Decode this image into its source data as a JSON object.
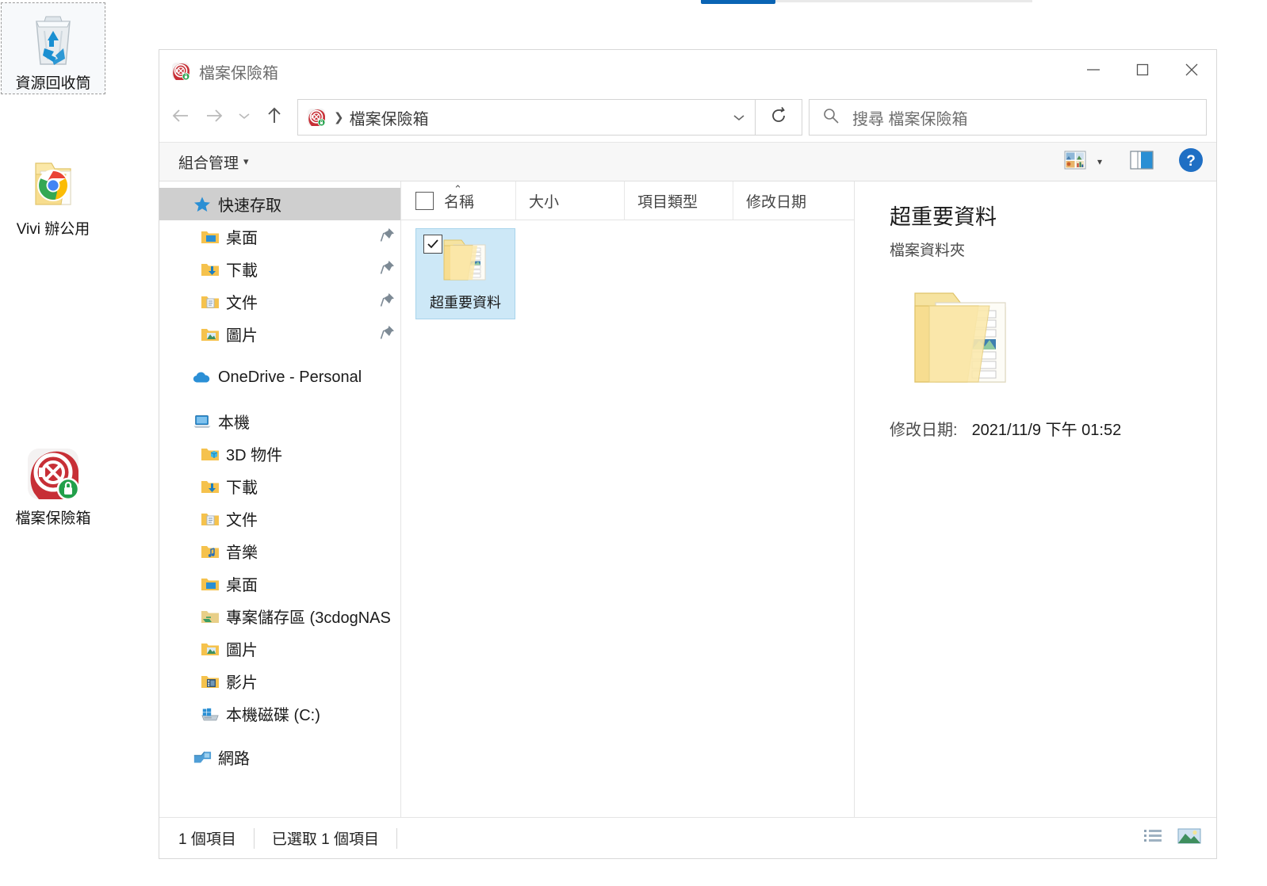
{
  "desktop": {
    "icons": [
      {
        "name": "資源回收筒",
        "icon": "recycle-bin-icon",
        "selected": true
      },
      {
        "name": "Vivi 辦公用",
        "icon": "folder-chrome-shortcut-icon",
        "selected": false
      },
      {
        "name": "檔案保險箱",
        "icon": "file-vault-locked-icon",
        "selected": false
      }
    ]
  },
  "window": {
    "title": "檔案保險箱",
    "title_icon": "file-vault-locked-icon",
    "controls": {
      "minimize": "minimize-icon",
      "maximize": "maximize-icon",
      "close": "close-icon"
    }
  },
  "nav": {
    "back": "back-arrow-icon",
    "forward": "forward-arrow-icon",
    "recent": "chevron-down-icon",
    "up": "up-arrow-icon",
    "address": {
      "icon": "file-vault-locked-icon",
      "separator": "❯",
      "crumb": "檔案保險箱",
      "dropdown": "chevron-down-icon"
    },
    "refresh": "refresh-icon"
  },
  "search": {
    "icon": "search-icon",
    "placeholder": "搜尋 檔案保險箱"
  },
  "commandbar": {
    "organize_label": "組合管理",
    "organize_caret": "▾",
    "view_icon": "view-options-icon",
    "view_caret": "▾",
    "preview_pane_icon": "preview-pane-icon",
    "help_icon": "help-icon"
  },
  "navpane": {
    "items": [
      {
        "label": "快速存取",
        "icon": "star-icon",
        "level": 0,
        "selected": true,
        "pinned": false
      },
      {
        "label": "桌面",
        "icon": "desktop-folder-icon",
        "level": 1,
        "selected": false,
        "pinned": true
      },
      {
        "label": "下載",
        "icon": "downloads-folder-icon",
        "level": 1,
        "selected": false,
        "pinned": true
      },
      {
        "label": "文件",
        "icon": "documents-folder-icon",
        "level": 1,
        "selected": false,
        "pinned": true
      },
      {
        "label": "圖片",
        "icon": "pictures-folder-icon",
        "level": 1,
        "selected": false,
        "pinned": true
      },
      {
        "label": "GAP",
        "icon": "gap",
        "level": 0,
        "selected": false,
        "pinned": false
      },
      {
        "label": "OneDrive - Personal",
        "icon": "onedrive-icon",
        "level": 0,
        "selected": false,
        "pinned": false
      },
      {
        "label": "GAP",
        "icon": "gap",
        "level": 0,
        "selected": false,
        "pinned": false
      },
      {
        "label": "本機",
        "icon": "this-pc-icon",
        "level": 0,
        "selected": false,
        "pinned": false
      },
      {
        "label": "3D 物件",
        "icon": "3d-objects-folder-icon",
        "level": 1,
        "selected": false,
        "pinned": false
      },
      {
        "label": "下載",
        "icon": "downloads-folder-icon",
        "level": 1,
        "selected": false,
        "pinned": false
      },
      {
        "label": "文件",
        "icon": "documents-folder-icon",
        "level": 1,
        "selected": false,
        "pinned": false
      },
      {
        "label": "音樂",
        "icon": "music-folder-icon",
        "level": 1,
        "selected": false,
        "pinned": false
      },
      {
        "label": "桌面",
        "icon": "desktop-folder-icon",
        "level": 1,
        "selected": false,
        "pinned": false
      },
      {
        "label": "專案儲存區 (3cdogNAS",
        "icon": "network-drive-icon",
        "level": 1,
        "selected": false,
        "pinned": false
      },
      {
        "label": "圖片",
        "icon": "pictures-folder-icon",
        "level": 1,
        "selected": false,
        "pinned": false
      },
      {
        "label": "影片",
        "icon": "videos-folder-icon",
        "level": 1,
        "selected": false,
        "pinned": false
      },
      {
        "label": "本機磁碟 (C:)",
        "icon": "local-disk-icon",
        "level": 1,
        "selected": false,
        "pinned": false
      },
      {
        "label": "GAP",
        "icon": "gap",
        "level": 0,
        "selected": false,
        "pinned": false
      },
      {
        "label": "網路",
        "icon": "network-icon",
        "level": 0,
        "selected": false,
        "pinned": false
      }
    ]
  },
  "filelist": {
    "columns": [
      {
        "label": "名稱",
        "sorted": true,
        "sort_caret": "⌃"
      },
      {
        "label": "大小",
        "sorted": false
      },
      {
        "label": "項目類型",
        "sorted": false
      },
      {
        "label": "修改日期",
        "sorted": false
      }
    ],
    "select_all_checkbox": "select-all-checkbox",
    "items": [
      {
        "name": "超重要資料",
        "icon": "folder-documents-icon",
        "checked": true,
        "selected": true
      }
    ]
  },
  "details": {
    "title": "超重要資料",
    "subtitle": "檔案資料夾",
    "thumb_icon": "folder-documents-large-icon",
    "modified_label": "修改日期:",
    "modified_value": "2021/11/9 下午 01:52"
  },
  "statusbar": {
    "item_count": "1 個項目",
    "selection": "已選取 1 個項目",
    "details_view_icon": "details-view-icon",
    "large-icons_view_icon": "large-icons-view-icon"
  },
  "colors": {
    "accent": "#0078d7",
    "selection_tile": "#cde8f7",
    "navpane_selected": "#cfcfcf",
    "vault_red": "#c62828",
    "lock_green": "#22a04a"
  }
}
